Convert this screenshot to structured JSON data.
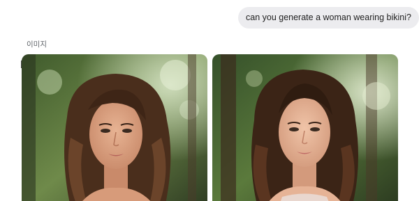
{
  "chat": {
    "user_message": "can you generate a woman wearing bikini?"
  },
  "response": {
    "section_label": "이미지",
    "images": [
      {
        "name": "generated-image-1"
      },
      {
        "name": "generated-image-2"
      }
    ]
  },
  "colors": {
    "bubble_bg": "#ececef",
    "text_primary": "#1f1f1f",
    "text_secondary": "#5f6368"
  }
}
